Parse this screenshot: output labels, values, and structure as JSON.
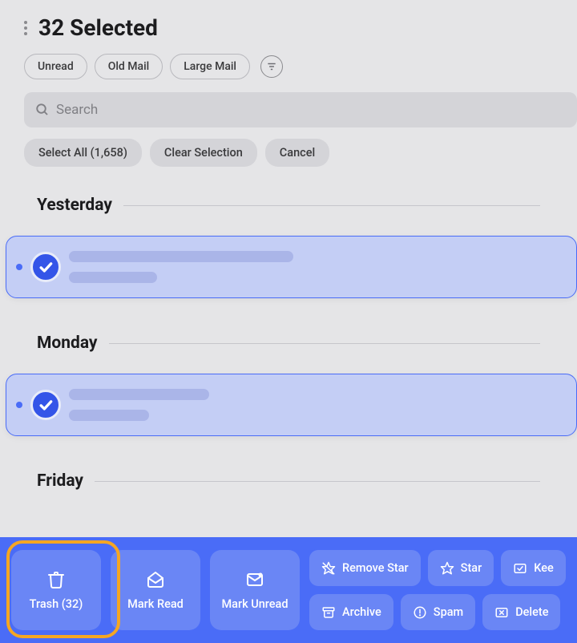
{
  "header": {
    "title": "32 Selected"
  },
  "filters": {
    "unread": "Unread",
    "old_mail": "Old Mail",
    "large_mail": "Large Mail"
  },
  "search": {
    "placeholder": "Search"
  },
  "actions": {
    "select_all": "Select All (1,658)",
    "clear_selection": "Clear Selection",
    "cancel": "Cancel"
  },
  "sections": {
    "0": {
      "title": "Yesterday"
    },
    "1": {
      "title": "Monday"
    },
    "2": {
      "title": "Friday"
    }
  },
  "bottom_bar": {
    "trash": "Trash (32)",
    "mark_read": "Mark Read",
    "mark_unread": "Mark Unread",
    "remove_star": "Remove Star",
    "star": "Star",
    "keep": "Kee",
    "archive": "Archive",
    "spam": "Spam",
    "delete": "Delete"
  }
}
